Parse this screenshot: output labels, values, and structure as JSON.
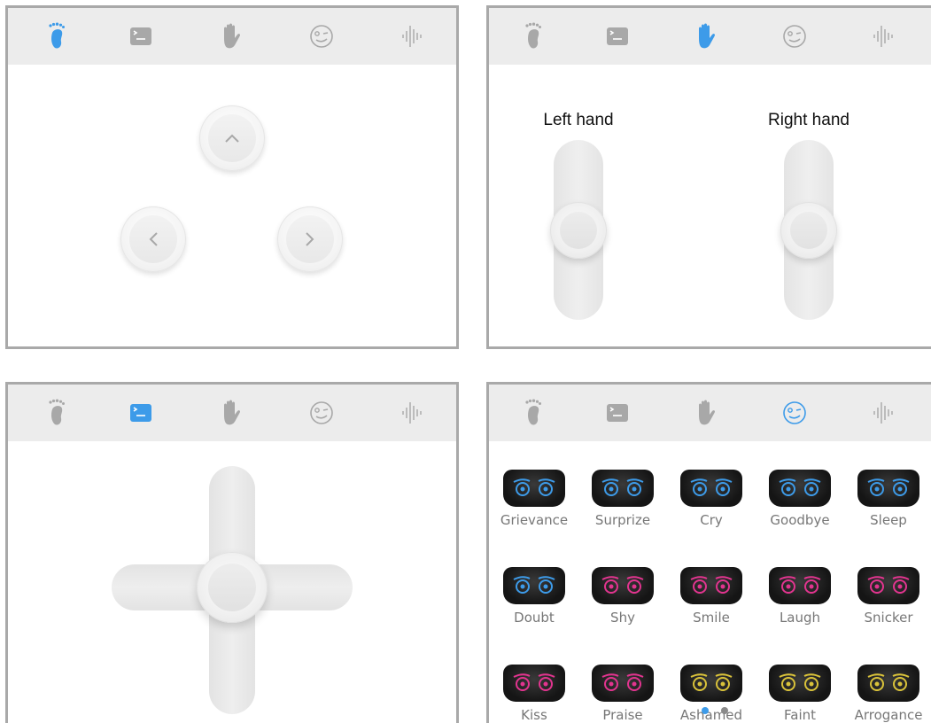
{
  "colors": {
    "active": "#3d9be9",
    "inactive": "#a8a8a8",
    "topbar": "#ececec",
    "pink": "#e2348f",
    "blue": "#3d9be9",
    "yellow": "#d9c23a"
  },
  "tab_icons": [
    "foot-icon",
    "head-screen-icon",
    "hand-icon",
    "face-icon",
    "voice-icon"
  ],
  "panels": [
    {
      "id": "move",
      "active_tab": 0
    },
    {
      "id": "hands",
      "active_tab": 2,
      "left_label": "Left hand",
      "right_label": "Right hand"
    },
    {
      "id": "head",
      "active_tab": 1
    },
    {
      "id": "expressions",
      "active_tab": 3
    }
  ],
  "expressions": [
    {
      "label": "Grievance",
      "color": "blue"
    },
    {
      "label": "Surprize",
      "color": "blue"
    },
    {
      "label": "Cry",
      "color": "blue"
    },
    {
      "label": "Goodbye",
      "color": "blue"
    },
    {
      "label": "Sleep",
      "color": "blue"
    },
    {
      "label": "Doubt",
      "color": "blue"
    },
    {
      "label": "Shy",
      "color": "pink"
    },
    {
      "label": "Smile",
      "color": "pink"
    },
    {
      "label": "Laugh",
      "color": "pink"
    },
    {
      "label": "Snicker",
      "color": "pink"
    },
    {
      "label": "Kiss",
      "color": "pink"
    },
    {
      "label": "Praise",
      "color": "pink"
    },
    {
      "label": "Ashamed",
      "color": "yellow"
    },
    {
      "label": "Faint",
      "color": "yellow"
    },
    {
      "label": "Arrogance",
      "color": "yellow"
    }
  ],
  "pagination": {
    "pages": 2,
    "current": 1
  }
}
